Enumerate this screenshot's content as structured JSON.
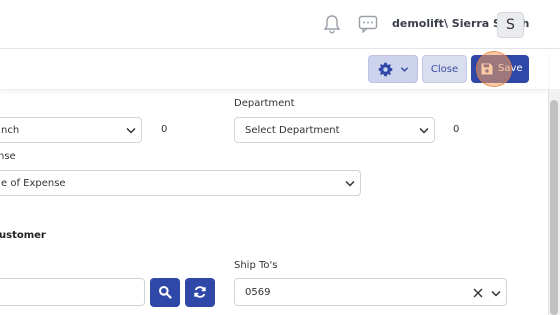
{
  "header": {
    "username": "demolift\\ Sierra Smith",
    "avatar_letter": "S"
  },
  "toolbar": {
    "close_label": "Close",
    "save_label": "Save"
  },
  "form": {
    "branch_value": "nch",
    "branch_count": "0",
    "department_label": "Department",
    "department_value": "Select Department",
    "department_count": "0",
    "expense_label": "nse",
    "expense_value": "e of Expense",
    "customer_section_label": "ustomer",
    "customer_input_value": "",
    "ship_to_label": "Ship To's",
    "ship_to_value": "0569"
  },
  "colors": {
    "primary": "#2f47a6",
    "close_button_bg": "#d9ddf0",
    "settings_button_bg": "#cdd3ec"
  },
  "icons": [
    "bell-icon",
    "chat-icon",
    "gear-icon",
    "chevron-down-icon",
    "floppy-disk-icon",
    "search-icon",
    "refresh-icon",
    "clear-icon"
  ]
}
